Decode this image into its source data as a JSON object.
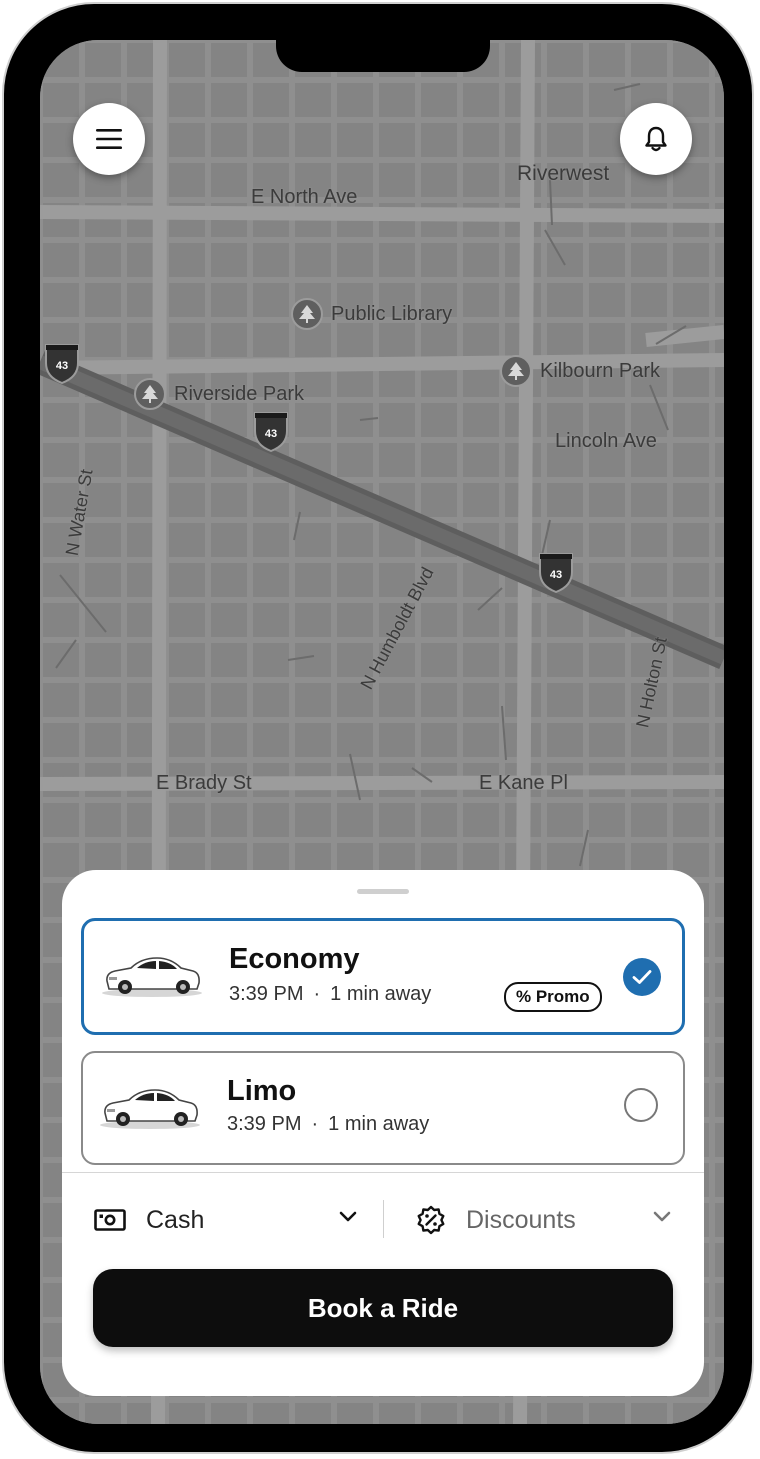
{
  "map": {
    "streets": [
      {
        "id": "e-north-ave",
        "label": "E North Ave"
      },
      {
        "id": "riverwest",
        "label": "Riverwest"
      },
      {
        "id": "lincoln-ave",
        "label": "Lincoln Ave"
      },
      {
        "id": "n-water-st",
        "label": "N Water St"
      },
      {
        "id": "n-humboldt-blvd",
        "label": "N Humboldt Blvd"
      },
      {
        "id": "n-holton-st",
        "label": "N Holton St"
      },
      {
        "id": "e-brady-st",
        "label": "E Brady St"
      },
      {
        "id": "e-kane-pl",
        "label": "E Kane Pl"
      }
    ],
    "pois": [
      {
        "label": "Public Library",
        "icon": "tree-icon"
      },
      {
        "label": "Kilbourn Park",
        "icon": "tree-icon"
      },
      {
        "label": "Riverside Park",
        "icon": "tree-icon"
      }
    ],
    "highway_shield": "43"
  },
  "top_controls": {
    "menu_icon": "hamburger-menu-icon",
    "bell_icon": "bell-icon"
  },
  "rides": [
    {
      "name": "Economy",
      "time": "3:39 PM",
      "separator": "·",
      "eta": "1 min away",
      "promo": "% Promo",
      "selected": true
    },
    {
      "name": "Limo",
      "time": "3:39 PM",
      "separator": "·",
      "eta": "1 min away",
      "selected": false
    }
  ],
  "payment": {
    "label": "Cash",
    "icon": "cash-icon"
  },
  "discounts": {
    "label": "Discounts",
    "icon": "discount-badge-icon"
  },
  "book_button": {
    "label": "Book a Ride"
  },
  "colors": {
    "accent": "#1f6eb0",
    "button": "#0d0d0d",
    "map": "#858585"
  }
}
